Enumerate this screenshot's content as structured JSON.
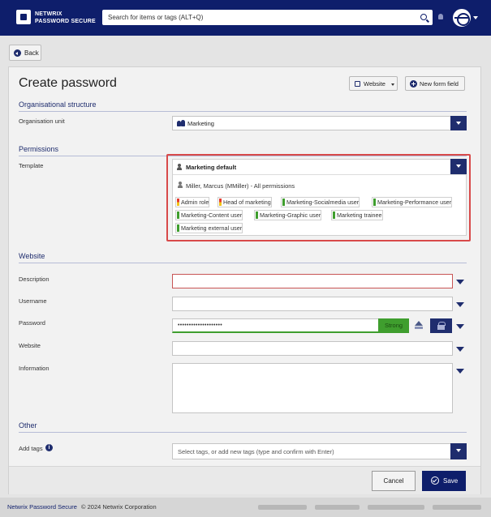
{
  "brand": {
    "line1": "NETWRIX",
    "line2": "PASSWORD SECURE"
  },
  "search": {
    "placeholder": "Search for items or tags (ALT+Q)"
  },
  "nav": {
    "back_label": "Back"
  },
  "form": {
    "title": "Create password",
    "website_btn": "Website",
    "new_form_field_btn": "New form field",
    "sections": {
      "org": "Organisational structure",
      "permissions": "Permissions",
      "website": "Website",
      "other": "Other"
    },
    "labels": {
      "org_unit": "Organisation unit",
      "template": "Template",
      "description": "Description",
      "username": "Username",
      "password": "Password",
      "website": "Website",
      "information": "Information",
      "add_tags": "Add tags"
    },
    "org_unit_value": "Marketing",
    "template_value": "Marketing default",
    "template_user": "Miller, Marcus (MMiller) - All permissions",
    "template_tags": [
      {
        "label": "Admin role",
        "color": "#e53b2f",
        "color2": "#f0c419"
      },
      {
        "label": "Head of marketing",
        "color": "#e53b2f",
        "color2": "#f0c419"
      },
      {
        "label": "Marketing-Socialmedia user",
        "color": "#3f9e2e"
      },
      {
        "label": "Marketing-Performance user",
        "color": "#3f9e2e"
      },
      {
        "label": "Marketing-Content user",
        "color": "#3f9e2e"
      },
      {
        "label": "Marketing-Graphic user",
        "color": "#3f9e2e"
      },
      {
        "label": "Marketing trainee",
        "color": "#3f9e2e"
      },
      {
        "label": "Marketing external user",
        "color": "#3f9e2e"
      }
    ],
    "password_masked": "••••••••••••••••••••",
    "strength": "Strong",
    "tags_placeholder": "Select tags, or add new tags (type and confirm with Enter)",
    "info_glyph": "i",
    "cancel_label": "Cancel",
    "save_label": "Save"
  },
  "footer": {
    "brand": "Netwrix Password Secure",
    "copyright": "© 2024 Netwrix Corporation"
  },
  "colors": {
    "primary": "#0e1e6b",
    "highlight": "#d84a4a",
    "strong": "#3f9e2e"
  }
}
